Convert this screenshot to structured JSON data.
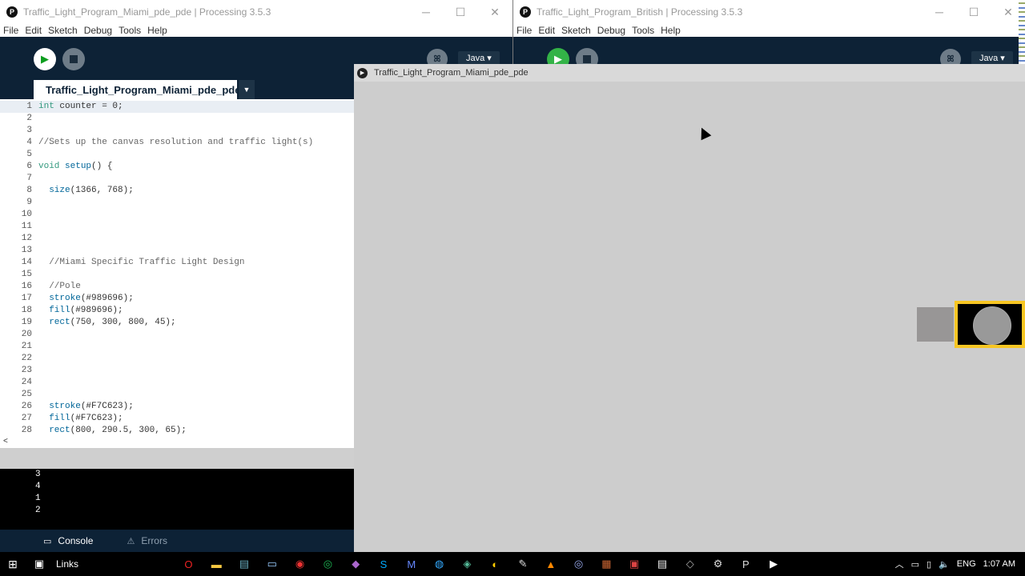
{
  "left_window": {
    "title": "Traffic_Light_Program_Miami_pde_pde | Processing 3.5.3",
    "menu": [
      "File",
      "Edit",
      "Sketch",
      "Debug",
      "Tools",
      "Help"
    ],
    "mode": "Java ▾",
    "tab_label": "Traffic_Light_Program_Miami_pde_pde",
    "editor": {
      "current_line": 1,
      "lines": [
        {
          "n": "1",
          "t": "int counter = 0;"
        },
        {
          "n": "2",
          "t": ""
        },
        {
          "n": "3",
          "t": ""
        },
        {
          "n": "4",
          "t": "//Sets up the canvas resolution and traffic light(s)"
        },
        {
          "n": "5",
          "t": ""
        },
        {
          "n": "6",
          "t": "void setup() {"
        },
        {
          "n": "7",
          "t": ""
        },
        {
          "n": "8",
          "t": "  size(1366, 768);"
        },
        {
          "n": "9",
          "t": ""
        },
        {
          "n": "10",
          "t": ""
        },
        {
          "n": "11",
          "t": ""
        },
        {
          "n": "12",
          "t": ""
        },
        {
          "n": "13",
          "t": ""
        },
        {
          "n": "14",
          "t": "  //Miami Specific Traffic Light Design"
        },
        {
          "n": "15",
          "t": ""
        },
        {
          "n": "16",
          "t": "  //Pole"
        },
        {
          "n": "17",
          "t": "  stroke(#989696);"
        },
        {
          "n": "18",
          "t": "  fill(#989696);"
        },
        {
          "n": "19",
          "t": "  rect(750, 300, 800, 45);"
        },
        {
          "n": "20",
          "t": ""
        },
        {
          "n": "21",
          "t": ""
        },
        {
          "n": "22",
          "t": ""
        },
        {
          "n": "23",
          "t": ""
        },
        {
          "n": "24",
          "t": ""
        },
        {
          "n": "25",
          "t": ""
        },
        {
          "n": "26",
          "t": "  stroke(#F7C623);"
        },
        {
          "n": "27",
          "t": "  fill(#F7C623);"
        },
        {
          "n": "28",
          "t": "  rect(800, 290.5, 300, 65);"
        }
      ]
    },
    "scroll_left": "<",
    "console_lines": [
      "3",
      "4",
      "1",
      "2"
    ],
    "console_tab": "Console",
    "errors_tab": "Errors"
  },
  "right_window": {
    "title": "Traffic_Light_Program_British | Processing 3.5.3",
    "menu": [
      "File",
      "Edit",
      "Sketch",
      "Debug",
      "Tools",
      "Help"
    ],
    "mode": "Java ▾"
  },
  "sketch_window": {
    "title": "Traffic_Light_Program_Miami_pde_pde",
    "colors": {
      "pole": "#989696",
      "housing_border": "#F7C623",
      "housing": "#000000",
      "lamp": "#999999"
    }
  },
  "taskbar": {
    "links": "Links",
    "language": "ENG",
    "time": "1:07 AM",
    "apps": [
      "opera-icon",
      "folder-icon",
      "notes-icon",
      "window-icon",
      "app-red-icon",
      "spotify-icon",
      "app-purple-icon",
      "skype-icon",
      "app-m-icon",
      "app-globe-icon",
      "app-vs-icon",
      "chrome-icon",
      "pen-icon",
      "app-fire-icon",
      "app-blue-icon",
      "app-settings2-icon",
      "app-red2-icon",
      "app-doc-icon",
      "app-bird-icon",
      "settings-icon",
      "processing-icon",
      "video-icon"
    ]
  }
}
